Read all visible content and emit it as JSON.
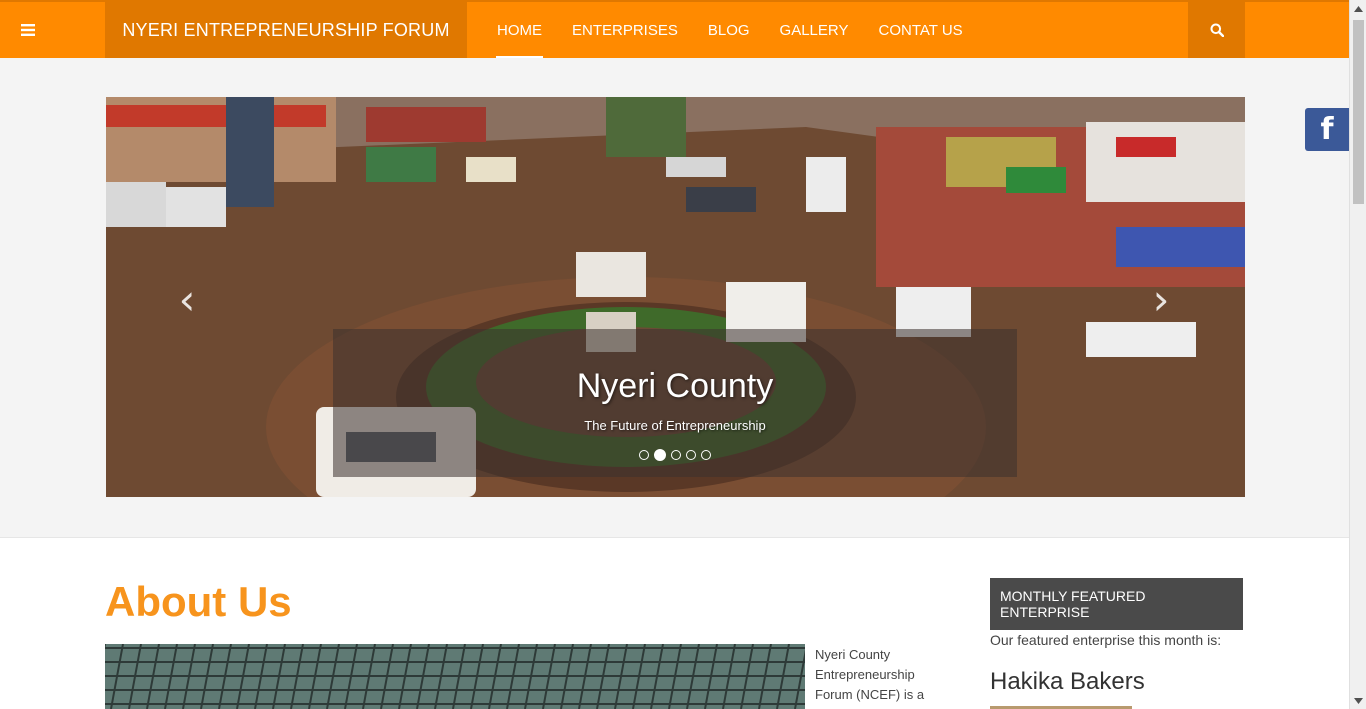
{
  "nav": {
    "brand": "NYERI ENTREPRENEURSHIP FORUM",
    "links": [
      "HOME",
      "ENTERPRISES",
      "BLOG",
      "GALLERY",
      "CONTAT US"
    ],
    "active": "HOME"
  },
  "slider": {
    "title": "Nyeri County",
    "subtitle": "The Future of Entrepreneurship",
    "slide_count": 5,
    "active_slide": 2,
    "prev_glyph": "‹",
    "next_glyph": "›"
  },
  "social": {
    "label": "f"
  },
  "about": {
    "title": "About Us",
    "text": "Nyeri County Entrepreneurship Forum (NCEF) is a"
  },
  "featured": {
    "heading": "MONTHLY FEATURED ENTERPRISE",
    "subtitle": "Our featured enterprise this month is:",
    "name": "Hakika Bakers"
  },
  "icons": {
    "menu": "menu-icon",
    "search": "search-icon",
    "facebook": "facebook-icon"
  },
  "colors": {
    "brand_orange": "#ff8a00",
    "dark_orange": "#e07800",
    "heading_orange": "#f7941d",
    "facebook_blue": "#3b5998"
  }
}
